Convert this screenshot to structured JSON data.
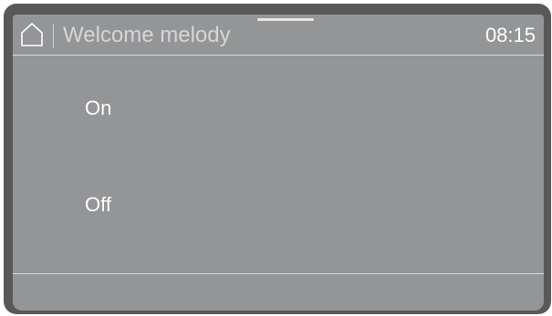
{
  "header": {
    "home_icon": "home-icon",
    "title": "Welcome melody",
    "time": "08:15"
  },
  "options": [
    {
      "label": "On"
    },
    {
      "label": "Off"
    }
  ],
  "colors": {
    "frame": "#58595b",
    "screen": "#949597",
    "text": "#ffffff",
    "title_text": "#d6d6d6",
    "divider": "#d9d9d9"
  }
}
